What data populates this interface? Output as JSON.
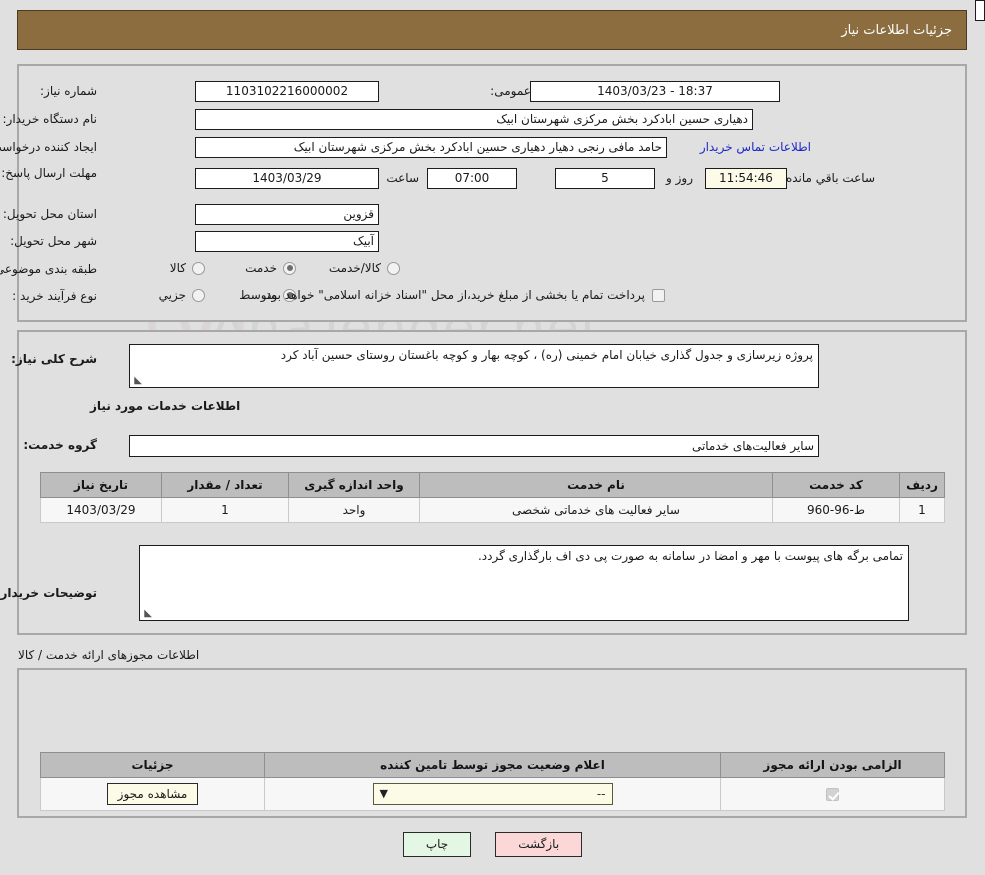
{
  "header": {
    "title": "جزئیات اطلاعات نیاز",
    "bar_color": "#8b6d3f"
  },
  "watermark": {
    "text": "AnaTender.net"
  },
  "top_panel": {
    "need_number_label": "شماره نیاز:",
    "need_number_value": "1103102216000002",
    "public_announce_label": "تاریخ و ساعت اعلان عمومی:",
    "public_announce_value": "1403/03/23 - 18:37",
    "buyer_org_label": "نام دستگاه خریدار:",
    "buyer_org_value": "دهیاری حسین ابادکرد بخش مرکزی شهرستان ابیک",
    "requester_label": "ایجاد کننده درخواست:",
    "requester_value": "حامد مافی رنجی دهیار  دهیاری حسین ابادکرد بخش مرکزی شهرستان ابیک",
    "contact_link": "اطلاعات تماس خریدار",
    "deadline_label": "مهلت ارسال پاسخ: تا تاریخ:",
    "deadline_date": "1403/03/29",
    "hour_label": "ساعت",
    "deadline_time": "07:00",
    "days_value": "5",
    "days_label": "روز و",
    "remaining_time": "11:54:46",
    "remaining_label": "ساعت باقي مانده",
    "province_label": "استان محل تحویل:",
    "province_value": "قزوین",
    "city_label": "شهر محل تحویل:",
    "city_value": "آبیک",
    "category_label": "طبقه بندی موضوعی:",
    "category_options": [
      {
        "label": "کالا",
        "selected": false
      },
      {
        "label": "خدمت",
        "selected": true
      },
      {
        "label": "کالا/خدمت",
        "selected": false
      }
    ],
    "process_label": "نوع فرآیند خرید :",
    "process_options": [
      {
        "label": "جزیي",
        "selected": false
      },
      {
        "label": "متوسط",
        "selected": true
      }
    ],
    "treasury_checkbox_checked": false,
    "treasury_text": "پرداخت تمام یا بخشی از مبلغ خرید،از محل \"اسناد خزانه اسلامی\" خواهد بود."
  },
  "mid_panel": {
    "general_desc_label": "شرح کلی نیاز:",
    "general_desc_value": "پروژه زیرسازی و جدول گذاری خیابان امام خمینی (ره) ، کوچه بهار و کوچه باغستان روستای حسین آباد کرد",
    "services_info_title": "اطلاعات خدمات مورد نیاز",
    "service_group_label": "گروه خدمت:",
    "service_group_value": "سایر فعالیت‌های خدماتی",
    "table": {
      "columns": [
        "ردیف",
        "کد خدمت",
        "نام خدمت",
        "واحد اندازه گیری",
        "تعداد / مقدار",
        "تاریخ نیاز"
      ],
      "rows": [
        [
          "1",
          "ط-96-960",
          "سایر فعالیت های خدماتی شخصی",
          "واحد",
          "1",
          "1403/03/29"
        ]
      ]
    },
    "buyer_notes_label": "توضیحات خریدار:",
    "buyer_notes_value": "تمامی برگه های پیوست با مهر و امضا در سامانه به صورت پی دی اف بارگذاری گردد."
  },
  "licenses": {
    "section_note": "اطلاعات مجوزهای ارائه خدمت / کالا",
    "table": {
      "columns": [
        "الزامی بودن ارائه مجوز",
        "اعلام وضعیت مجوز توسط تامین کننده",
        "جزئیات"
      ],
      "rows": [
        {
          "required_checked": true,
          "status_value": "--",
          "detail_button": "مشاهده مجوز"
        }
      ]
    }
  },
  "footer": {
    "print_label": "چاپ",
    "back_label": "بازگشت"
  }
}
